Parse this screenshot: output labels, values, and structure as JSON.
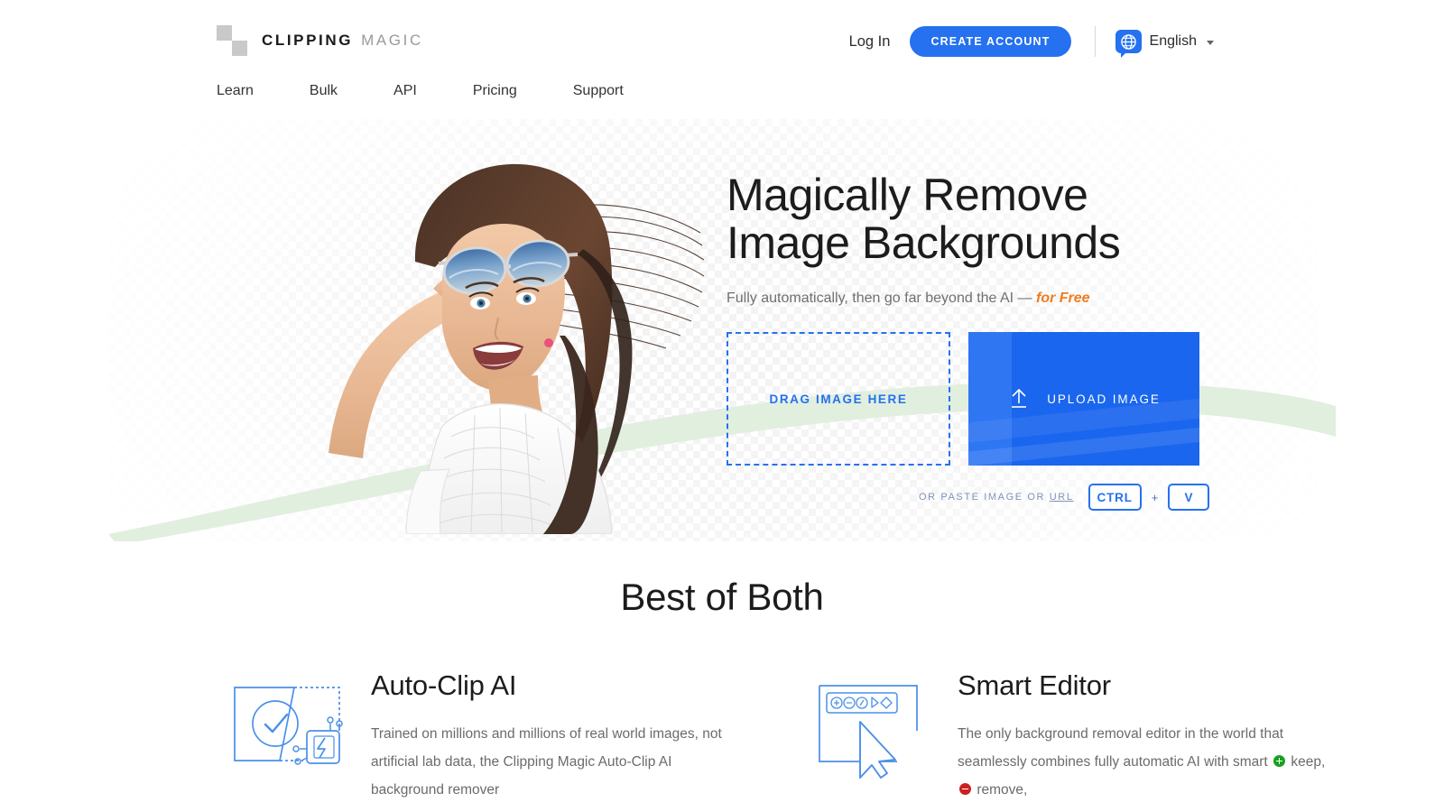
{
  "header": {
    "logo": {
      "mark_icon": "checkerboard-icon",
      "word_primary": "CLIPPING",
      "word_secondary": "MAGIC"
    },
    "login_label": "Log In",
    "create_account_label": "CREATE ACCOUNT",
    "language": {
      "icon": "globe-speech-bubble-icon",
      "label": "English",
      "caret_icon": "chevron-down-icon"
    },
    "nav": [
      {
        "label": "Learn"
      },
      {
        "label": "Bulk"
      },
      {
        "label": "API"
      },
      {
        "label": "Pricing"
      },
      {
        "label": "Support"
      }
    ]
  },
  "hero": {
    "heading": "Magically Remove\nImage Backgrounds",
    "subtitle_plain": "Fully automatically, then go far beyond the AI — ",
    "subtitle_accent": "for Free",
    "dropzone_label": "DRAG IMAGE HERE",
    "upload_label": "UPLOAD IMAGE",
    "upload_icon": "upload-arrow-icon",
    "paste_prefix": "OR PASTE IMAGE OR ",
    "paste_link": "URL",
    "key_ctrl": "CTRL",
    "key_plus": "+",
    "key_v": "V",
    "photo_alt": "smiling-woman-sunglasses-photo"
  },
  "best_of_both": {
    "title": "Best of Both",
    "features": [
      {
        "icon": "auto-clip-ai-icon",
        "title": "Auto-Clip AI",
        "body": "Trained on millions and millions of real world images, not artificial lab data, the Clipping Magic Auto-Clip AI background remover"
      },
      {
        "icon": "smart-editor-icon",
        "title": "Smart Editor",
        "body_1": "The only background removal editor in the world that seamlessly combines fully automatic AI with smart ",
        "body_keep": "keep,",
        "body_remove": "remove,"
      }
    ]
  },
  "colors": {
    "brand_blue": "#2571f0",
    "upload_blue": "#1a66ee",
    "accent_orange": "#f07c1c",
    "keep_green": "#18a020",
    "remove_red": "#cc2020",
    "swoosh_green": "#dfeedd",
    "text_dark": "#1c1c1c",
    "text_muted": "#6b6b6b"
  }
}
